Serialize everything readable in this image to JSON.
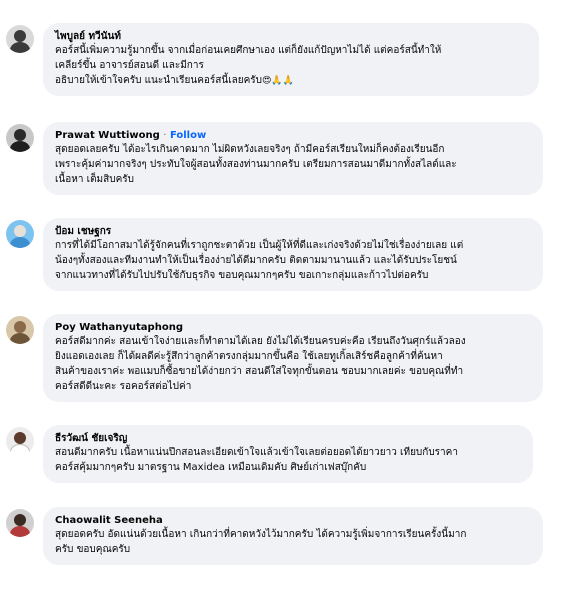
{
  "comments": [
    {
      "author": "ไพบูลย์ ทวีนันท์",
      "avatar_color": "#3a3a3a",
      "lines": [
        "คอร์สนี้เพิ่มความรู้มากขึ้น จากเมื่อก่อนเคยศึกษาเอง แต่ก็ยังแก้ปัญหาไม่ได้ แต่คอร์สนี้ทำให้",
        "เคลียร์ขึ้น อาจารย์สอนดี และมีการ",
        "อธิบายให้เข้าใจครับ แนะนำเรียนคอร์สนี้เลยครับ"
      ],
      "emojis": [
        "😍",
        "🙏",
        "🙏"
      ]
    },
    {
      "author": "Prawat Wuttiwong",
      "separator": "·",
      "follow_label": "Follow",
      "avatar_color": "#2b2b2b",
      "lines": [
        "สุดยอดเลยครับ ได้อะไรเกินคาดมาก ไม่ผิดหวังเลยจริงๆ ถ้ามีคอร์สเรียนใหม่ก็คงต้องเรียนอีก",
        "เพราะคุ้มค่ามากจริงๆ ประทับใจผู้สอนทั้งสองท่านมากครับ เตรียมการสอนมาดีมากทั้งสไลด์และ",
        "เนื้อหา เต็มสิบครับ"
      ]
    },
    {
      "author": "ป้อม เชษฐกร",
      "avatar_color": "#3d8fd1",
      "lines": [
        "การที่ได้มีโอกาสมาได้รู้จักคนที่เราถูกชะตาด้วย เป็นผู้ให้ที่ดีและเก่งจริงด้วยไม่ใช่เรื่องง่ายเลย แต่",
        "น้องๆทั้งสองและทีมงานทำให้เป็นเรื่องง่ายได้ดีมากครับ ติดตามมานานแล้ว และได้รับประโยชน์",
        "จากแนวทางที่ได้รับไปปรับใช้กับธุรกิจ ขอบคุณมากๆครับ ขอเกาะกลุ่มและก้าวไปต่อครับ"
      ]
    },
    {
      "author": "Poy Wathanyutaphong",
      "avatar_color": "#8a6a4a",
      "lines": [
        "คอร์สดีมากค่ะ สอนเข้าใจง่ายและก็ทำตามได้เลย ยังไม่ได้เรียนครบค่ะคือ เรียนถึงวันศุกร์แล้วลอง",
        "ยิงแอดเองเลย ก็ได้ผลดีค่ะรู้สึกว่าลูกค้าตรงกลุ่มมากขึ้นคือ ใช้เลยทูเกิ้ลเสิร์ชคือลูกค้าที่ค้นหา",
        "สินค้าของเราค่ะ พอแมบก็ซื้อขายได้ง่ายกว่า สอนดีใส่ใจทุกขั้นตอน ชอบมากเลยค่ะ ขอบคุณที่ทำ",
        "คอร์สดีดีนะคะ รอคอร์สต่อไปค่า"
      ]
    },
    {
      "author": "ธีรวัฒน์ ชัยเจริญ",
      "avatar_color": "#5a3a2a",
      "lines": [
        "สอนดีมากครับ เนื้อหาแน่นปึกสอนละเอียดเข้าใจแล้วเข้าใจเลยต่อยอดได้ยาวยาว เทียบกับราคา",
        "คอร์สคุ้มมากๆครับ มาตรฐาน Maxidea เหมือนเดิมคับ ศิษย์เก่าเฟสบุ๊กคับ"
      ]
    },
    {
      "author": "Chaowalit Seeneha",
      "avatar_color": "#b23a3a",
      "lines": [
        "สุดยอดครับ อัดแน่นด้วยเนื้อหา เกินกว่าที่คาดหวังไว้มากครับ ได้ความรู้เพิ่มจาการเรียนครั้งนี้มาก",
        "ครับ ขอบคุณครับ"
      ]
    }
  ]
}
